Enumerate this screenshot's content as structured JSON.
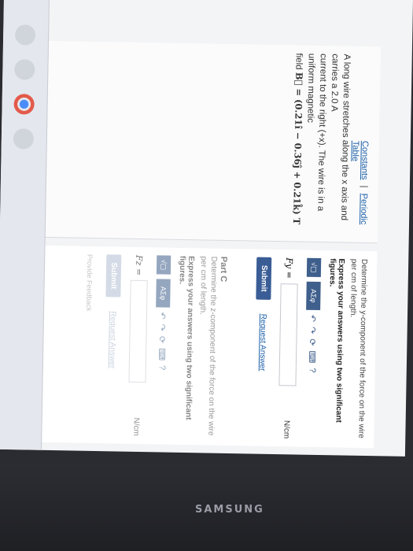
{
  "links": {
    "constants": "Constants",
    "separator": "|",
    "periodic_table": "Periodic Table"
  },
  "problem": {
    "line1": "A long wire stretches along the x axis and carries a 2.0 A",
    "line2": "current to the right (+x). The wire is in a uniform magnetic",
    "line3_prefix": "field",
    "field_expr": "B⃗ = (0.21î − 0.36ĵ + 0.21k̂) T"
  },
  "part_b": {
    "prompt": "Determine the y-component of the force on the wire per cm of length.",
    "instruction": "Express your answers using two significant figures.",
    "var_label": "Fy =",
    "unit": "N/cm",
    "submit_label": "Submit",
    "request_label": "Request Answer"
  },
  "part_c": {
    "title": "Part C",
    "prompt": "Determine the z-component of the force on the wire per cm of length.",
    "instruction": "Express your answers using two significant figures.",
    "var_label": "Fz =",
    "unit": "N/cm",
    "submit_label": "Submit",
    "request_label": "Request Answer",
    "feedback": "Provide Feedback"
  },
  "toolbar": {
    "sqrt_label": "√▢",
    "greek_label": "ΑΣφ"
  },
  "brand": "SAMSUNG",
  "colors": {
    "accent": "#3a5d96",
    "link": "#1a5fa8"
  }
}
